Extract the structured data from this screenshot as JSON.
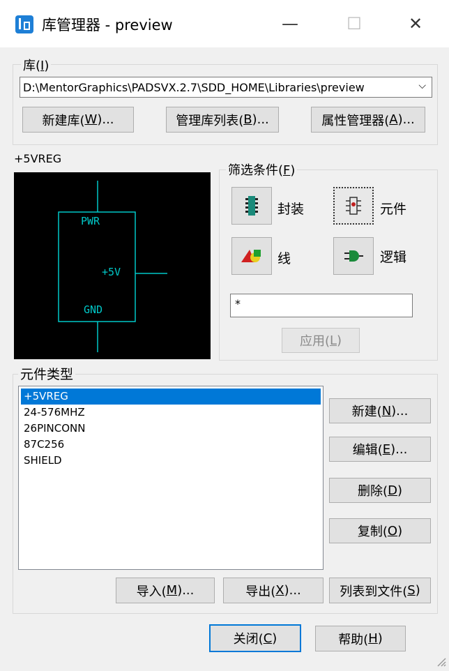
{
  "window": {
    "title": "库管理器 - preview",
    "minimize": "—",
    "maximize": "☐",
    "close": "✕"
  },
  "library_group": {
    "label": "库(",
    "label_key": "I",
    "label_end": ")",
    "path": "D:\\MentorGraphics\\PADSVX.2.7\\SDD_HOME\\Libraries\\preview",
    "new_library": {
      "text": "新建库(",
      "key": "W",
      "end": ")..."
    },
    "manage_list": {
      "text": "管理库列表(",
      "key": "B",
      "end": ")..."
    },
    "attr_manager": {
      "text": "属性管理器(",
      "key": "A",
      "end": ")..."
    }
  },
  "preview": {
    "name": "+5VREG",
    "pin_labels": [
      "PWR",
      "+5V",
      "GND"
    ]
  },
  "filter": {
    "label": "筛选条件(",
    "label_key": "F",
    "label_end": ")",
    "decal": "封装",
    "part": "元件",
    "line": "线",
    "logic": "逻辑",
    "search_value": "*",
    "apply": {
      "text": "应用(",
      "key": "L",
      "end": ")"
    }
  },
  "part_types": {
    "label": "元件类型",
    "items": [
      "+5VREG",
      "24-576MHZ",
      "26PINCONN",
      "87C256",
      "SHIELD"
    ],
    "new": {
      "text": "新建(",
      "key": "N",
      "end": ")..."
    },
    "edit": {
      "text": "编辑(",
      "key": "E",
      "end": ")..."
    },
    "delete": {
      "text": "删除(",
      "key": "D",
      "end": ")"
    },
    "copy": {
      "text": "复制(",
      "key": "O",
      "end": ")"
    },
    "import": {
      "text": "导入(",
      "key": "M",
      "end": ")..."
    },
    "export": {
      "text": "导出(",
      "key": "X",
      "end": ")..."
    },
    "list_to_file": {
      "text": "列表到文件(",
      "key": "S",
      "end": ")"
    }
  },
  "footer": {
    "close": {
      "text": "关闭(",
      "key": "C",
      "end": ")"
    },
    "help": {
      "text": "帮助(",
      "key": "H",
      "end": ")"
    }
  },
  "colors": {
    "accent": "#0078d7",
    "preview_bg": "#000000",
    "schematic": "#00c8c8"
  }
}
